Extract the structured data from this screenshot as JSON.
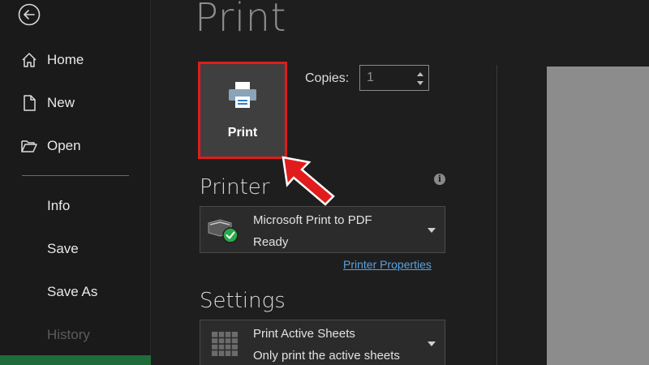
{
  "nav": {
    "home": "Home",
    "new": "New",
    "open": "Open",
    "info": "Info",
    "save": "Save",
    "save_as": "Save As",
    "history": "History"
  },
  "page": {
    "title": "Print"
  },
  "print_button": {
    "label": "Print"
  },
  "copies": {
    "label": "Copies:",
    "value": "1"
  },
  "printer": {
    "heading": "Printer",
    "name": "Microsoft Print to PDF",
    "status": "Ready",
    "properties_link": "Printer Properties",
    "info_icon_glyph": "i"
  },
  "settings": {
    "heading": "Settings",
    "option_title": "Print Active Sheets",
    "option_desc": "Only print the active sheets"
  },
  "colors": {
    "highlight_border": "#e01c1c",
    "link": "#5aa3e0",
    "ready_check": "#2aa84a"
  },
  "icons": [
    "back-arrow-icon",
    "home-icon",
    "new-document-icon",
    "open-folder-icon",
    "printer-icon",
    "pointer-arrow-icon",
    "info-icon",
    "printer-status-icon",
    "sheets-icon"
  ]
}
